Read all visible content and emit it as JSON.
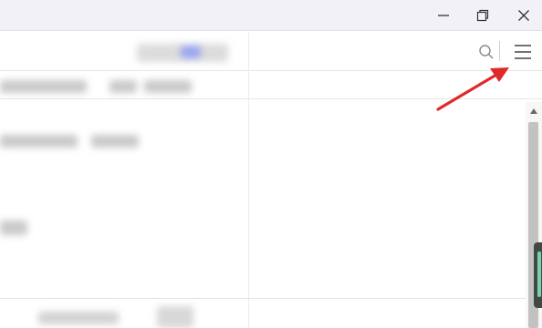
{
  "window": {
    "minimize_icon": "minimize-icon",
    "restore_icon": "restore-icon",
    "close_icon": "close-icon"
  },
  "toolbar": {
    "search_icon": "search-icon",
    "menu_icon": "hamburger-menu-icon"
  },
  "annotation": {
    "type": "arrow",
    "color": "#e0292b",
    "points_to": "menu-button"
  },
  "colors": {
    "titlebar": "#f3f1f8",
    "arrow": "#e0292b",
    "side_tab": "#3f4a46",
    "side_tab_accent": "#7bd0b0"
  }
}
